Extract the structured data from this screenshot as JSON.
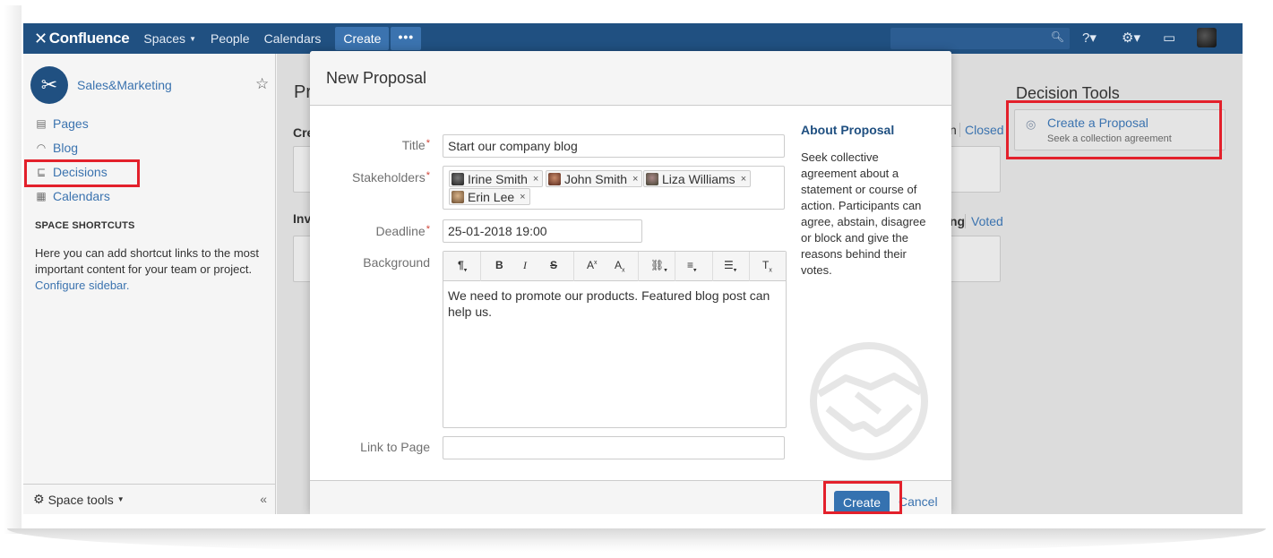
{
  "topnav": {
    "brand": "Confluence",
    "spaces": "Spaces",
    "people": "People",
    "calendars": "Calendars",
    "create": "Create",
    "more": "•••"
  },
  "sidebar": {
    "space_name": "Sales&Marketing",
    "items": [
      {
        "label": "Pages",
        "icon": "pages-icon"
      },
      {
        "label": "Blog",
        "icon": "rss-icon"
      },
      {
        "label": "Decisions",
        "icon": "decisions-icon"
      },
      {
        "label": "Calendars",
        "icon": "calendar-icon"
      }
    ],
    "shortcuts_heading": "SPACE SHORTCUTS",
    "shortcuts_text": "Here you can add shortcut links to the most important content for your team or project.",
    "configure_link": "Configure sidebar.",
    "space_tools": "Space tools",
    "collapse": "«"
  },
  "main": {
    "title_fragment": "Pr",
    "section1_fragment": "Cre",
    "section2_fragment": "Inv",
    "tab1_fragment": "n",
    "tab1_closed": "Closed",
    "tab2_fragment": "ng",
    "tab2_voted": "Voted"
  },
  "decision_tools": {
    "title": "Decision Tools",
    "card_title": "Create a Proposal",
    "card_desc": "Seek a collection agreement"
  },
  "modal": {
    "title": "New Proposal",
    "labels": {
      "title": "Title",
      "stakeholders": "Stakeholders",
      "deadline": "Deadline",
      "background": "Background",
      "link_to_page": "Link to Page"
    },
    "required_mark": "*",
    "title_value": "Start our company blog",
    "stakeholders": [
      "Irine Smith",
      "John Smith",
      "Liza Williams",
      "Erin Lee"
    ],
    "chip_remove": "×",
    "deadline_value": "25-01-2018 19:00",
    "background_value": "We need to promote our products. Featured blog post can help us.",
    "link_to_page_value": "",
    "about_heading": "About Proposal",
    "about_text": "Seek collective agreement about a statement or course of action. Participants can agree, abstain, disagree or block and give the reasons behind their votes.",
    "create_button": "Create",
    "cancel_link": "Cancel"
  },
  "colors": {
    "topnav_bg": "#205081",
    "link": "#3b73af",
    "primary_button": "#3572b0",
    "highlight": "#e3202b",
    "required": "#d04437"
  }
}
